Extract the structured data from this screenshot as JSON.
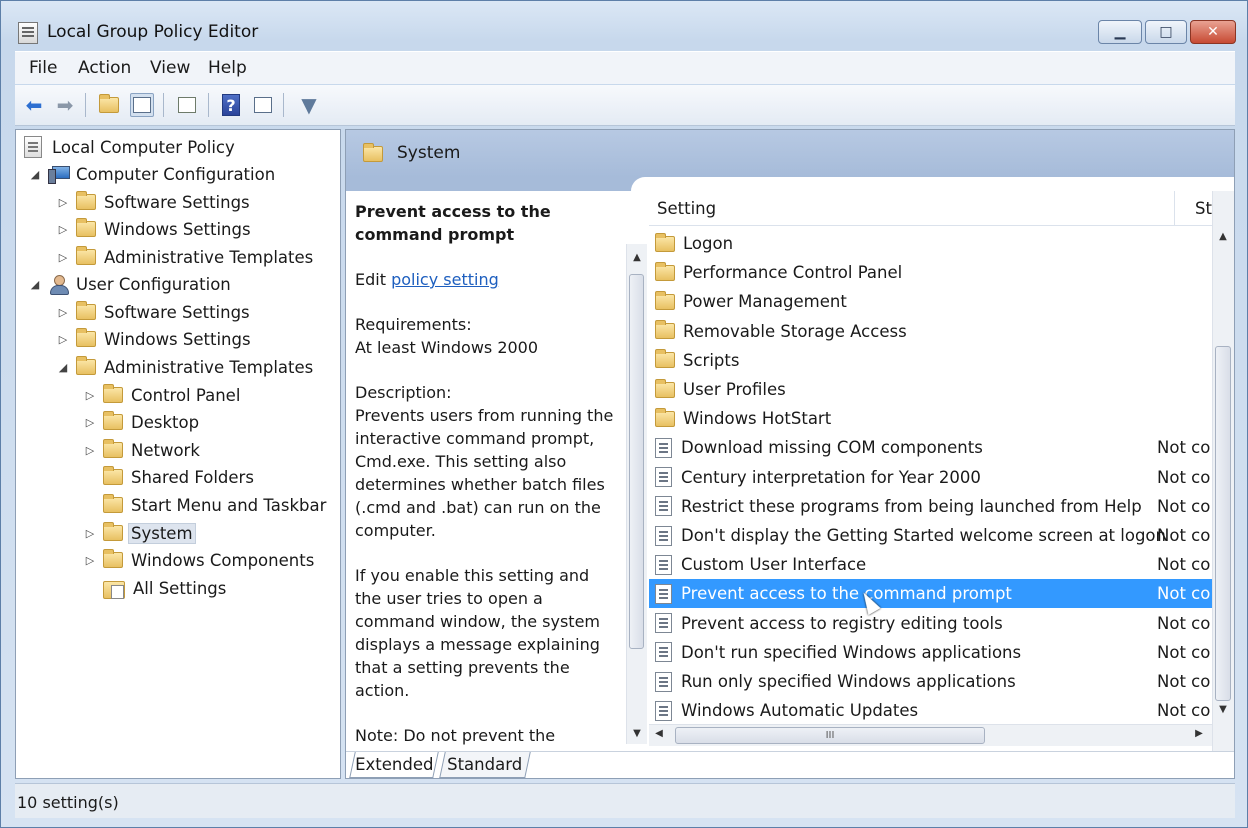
{
  "window": {
    "title": "Local Group Policy Editor",
    "minimize_glyph": "▁",
    "maximize_glyph": "□",
    "close_glyph": "✕"
  },
  "menu": {
    "file": "File",
    "action": "Action",
    "view": "View",
    "help": "Help"
  },
  "toolbar": {
    "back": "back-arrow-icon",
    "forward": "forward-arrow-icon",
    "up": "up-folder-icon",
    "show_hide_tree": "show-hide-console-tree-icon",
    "export": "export-list-icon",
    "help": "help-icon",
    "help_glyph": "?",
    "properties": "properties-icon",
    "filter": "filter-icon"
  },
  "tree": {
    "root": "Local Computer Policy",
    "computer_config": "Computer Configuration",
    "cc_software": "Software Settings",
    "cc_windows": "Windows Settings",
    "cc_admin": "Administrative Templates",
    "user_config": "User Configuration",
    "uc_software": "Software Settings",
    "uc_windows": "Windows Settings",
    "uc_admin": "Administrative Templates",
    "control_panel": "Control Panel",
    "desktop": "Desktop",
    "network": "Network",
    "shared_folders": "Shared Folders",
    "start_menu": "Start Menu and Taskbar",
    "system": "System",
    "windows_components": "Windows Components",
    "all_settings": "All Settings"
  },
  "right_pane": {
    "header_title": "System"
  },
  "description": {
    "title": "Prevent access to the command prompt",
    "edit_prefix": "Edit",
    "edit_link": "policy setting",
    "requirements_label": "Requirements:",
    "requirements_value": "At least Windows 2000",
    "description_label": "Description:",
    "description_text": "Prevents users from running the interactive command prompt, Cmd.exe. This setting also determines whether batch files (.cmd and .bat) can run on the computer.",
    "enable_text": "If you enable this setting and the user tries to open a command window, the system displays a message explaining that a setting prevents the action.",
    "note_text": "Note: Do not prevent the computer from running batch"
  },
  "list": {
    "col_setting": "Setting",
    "col_state": "St",
    "folders": [
      "Logon",
      "Performance Control Panel",
      "Power Management",
      "Removable Storage Access",
      "Scripts",
      "User Profiles",
      "Windows HotStart"
    ],
    "settings": [
      {
        "name": "Download missing COM components",
        "state": "Not co"
      },
      {
        "name": "Century interpretation for Year 2000",
        "state": "Not co"
      },
      {
        "name": "Restrict these programs from being launched from Help",
        "state": "Not co"
      },
      {
        "name": "Don't display the Getting Started welcome screen at logon",
        "state": "Not co"
      },
      {
        "name": "Custom User Interface",
        "state": "Not co"
      },
      {
        "name": "Prevent access to the command prompt",
        "state": "Not co"
      },
      {
        "name": "Prevent access to registry editing tools",
        "state": "Not co"
      },
      {
        "name": "Don't run specified Windows applications",
        "state": "Not co"
      },
      {
        "name": "Run only specified Windows applications",
        "state": "Not co"
      },
      {
        "name": "Windows Automatic Updates",
        "state": "Not co"
      }
    ],
    "selected_index": 5,
    "hscroll_grip": "III"
  },
  "tabs": {
    "extended": "Extended",
    "standard": "Standard"
  },
  "status": {
    "text": "10 setting(s)"
  }
}
